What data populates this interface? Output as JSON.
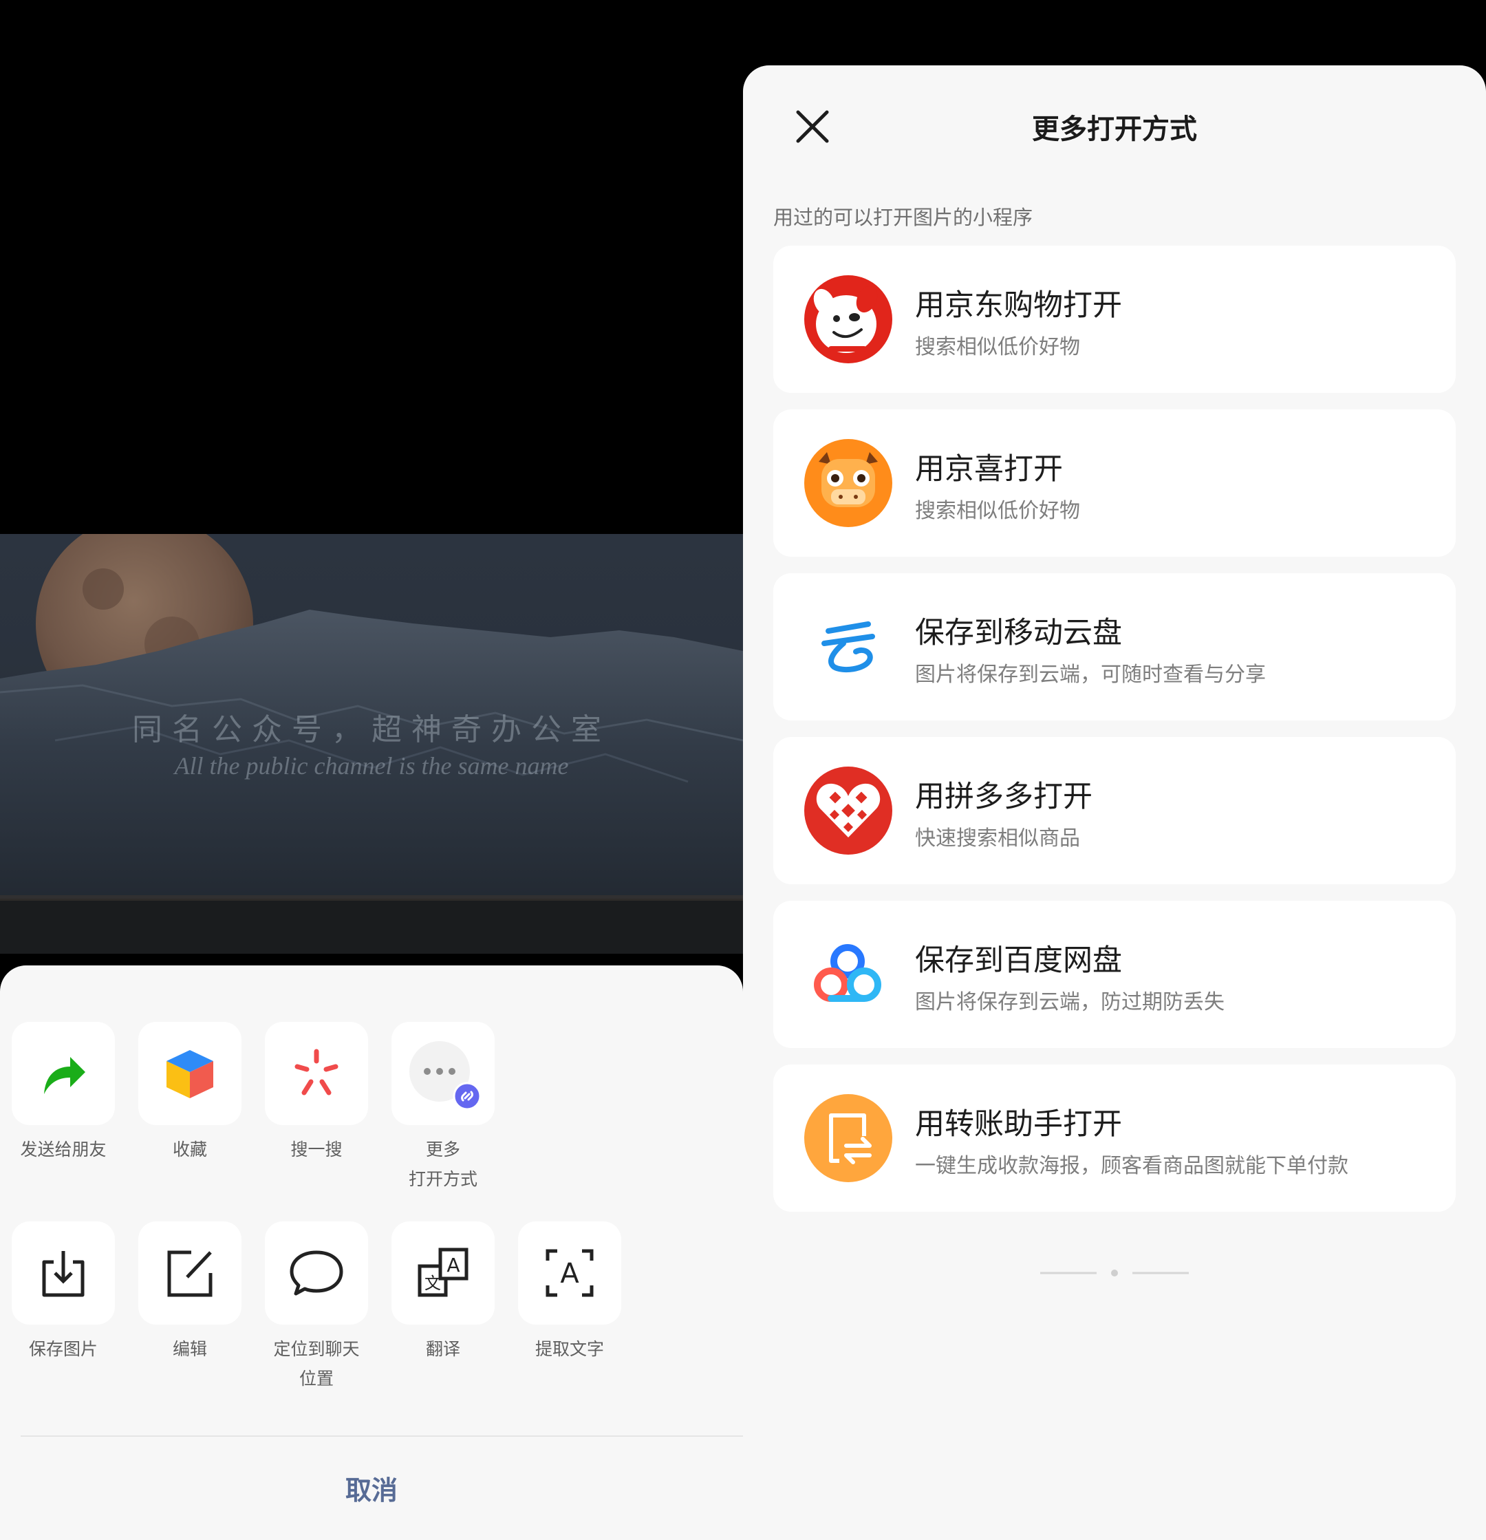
{
  "left": {
    "watermark_cn": "同名公众号，超神奇办公室",
    "watermark_en": "All the public channel is the same name",
    "row1": [
      {
        "id": "send",
        "label": "发送给朋友",
        "icon": "share-arrow-icon"
      },
      {
        "id": "favorite",
        "label": "收藏",
        "icon": "cube-icon"
      },
      {
        "id": "search",
        "label": "搜一搜",
        "icon": "search-spark-icon"
      },
      {
        "id": "more",
        "label": "更多\n打开方式",
        "label_line1": "更多",
        "label_line2": "打开方式",
        "icon": "more-dots-icon"
      }
    ],
    "row2": [
      {
        "id": "save",
        "label": "保存图片",
        "icon": "download-icon"
      },
      {
        "id": "edit",
        "label": "编辑",
        "icon": "edit-icon"
      },
      {
        "id": "locate",
        "label_line1": "定位到聊天",
        "label_line2": "位置",
        "icon": "chat-bubble-icon"
      },
      {
        "id": "translate",
        "label": "翻译",
        "icon": "translate-icon"
      },
      {
        "id": "ocr",
        "label": "提取文字",
        "icon": "text-extract-icon"
      }
    ],
    "cancel": "取消",
    "colors": {
      "accent": "#576b95",
      "green_arrow": "#1aad19"
    }
  },
  "right": {
    "title": "更多打开方式",
    "section_header": "用过的可以打开图片的小程序",
    "items": [
      {
        "title": "用京东购物打开",
        "subtitle": "搜索相似低价好物",
        "icon": "jd-dog-icon"
      },
      {
        "title": "用京喜打开",
        "subtitle": "搜索相似低价好物",
        "icon": "jingxi-cow-icon"
      },
      {
        "title": "保存到移动云盘",
        "subtitle": "图片将保存到云端，可随时查看与分享",
        "icon": "mobile-cloud-icon"
      },
      {
        "title": "用拼多多打开",
        "subtitle": "快速搜索相似商品",
        "icon": "pinduoduo-icon"
      },
      {
        "title": "保存到百度网盘",
        "subtitle": "图片将保存到云端，防过期防丢失",
        "icon": "baidu-netdisk-icon"
      },
      {
        "title": "用转账助手打开",
        "subtitle": "一键生成收款海报，顾客看商品图就能下单付款",
        "icon": "transfer-assistant-icon"
      }
    ]
  }
}
